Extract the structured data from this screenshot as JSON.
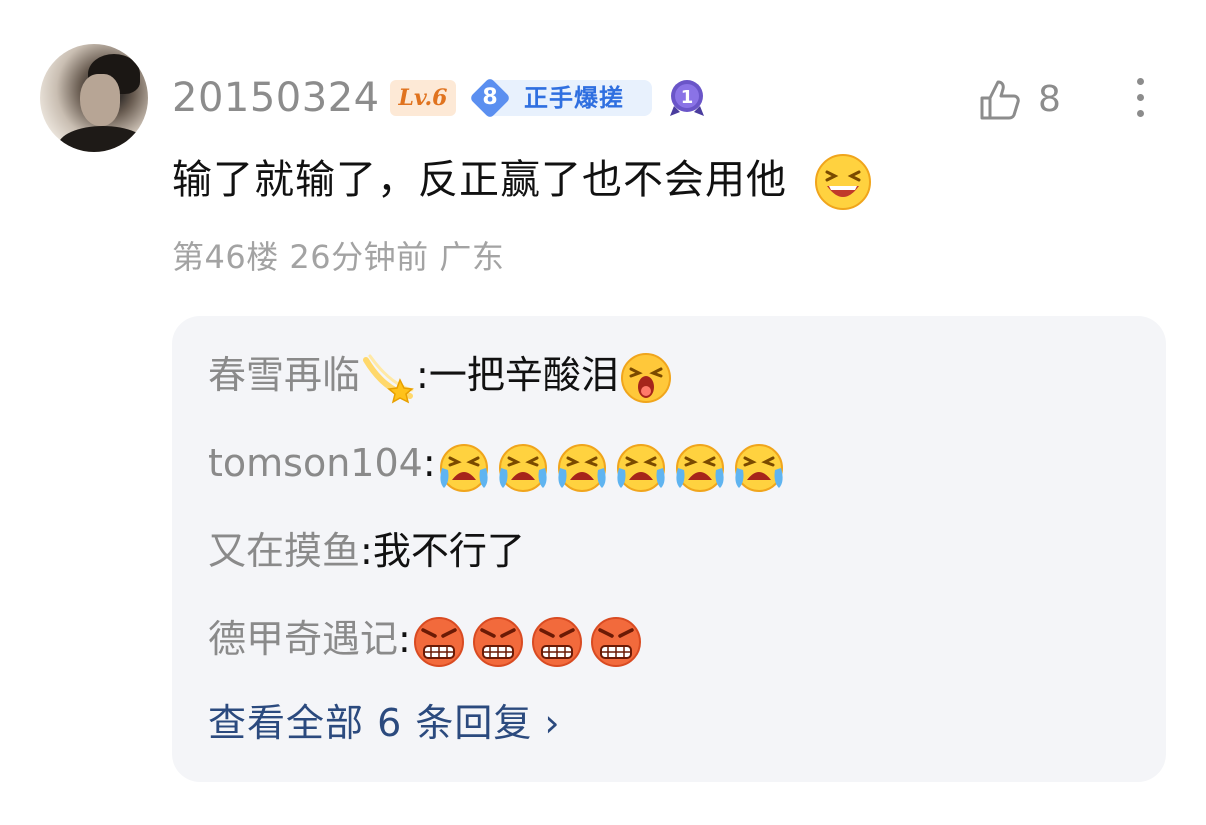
{
  "user": {
    "name": "20150324",
    "level_badge": "Lv.6",
    "medal": {
      "number": "8",
      "title": "正手爆搓"
    },
    "rank_number": "1"
  },
  "actions": {
    "like_count": "8",
    "like_icon": "thumbs-up-icon",
    "more_icon": "more-vertical-icon"
  },
  "comment": {
    "text": "输了就输了，反正赢了也不会用他",
    "emoji": "laughing-squint-emoji"
  },
  "meta": {
    "floor": "第46楼",
    "time": "26分钟前",
    "location": "广东"
  },
  "replies": [
    {
      "name": "春雪再临",
      "name_emoji": "shooting-star-emoji",
      "separator": ":",
      "text": "一把辛酸泪",
      "emojis": [
        "crying-loud-emoji"
      ]
    },
    {
      "name": "tomson104",
      "separator": ":",
      "text": "",
      "emojis": [
        "crying-face-emoji",
        "crying-face-emoji",
        "crying-face-emoji",
        "crying-face-emoji",
        "crying-face-emoji",
        "crying-face-emoji"
      ]
    },
    {
      "name": "又在摸鱼",
      "separator": ":",
      "text": "我不行了",
      "emojis": []
    },
    {
      "name": "德甲奇遇记",
      "separator": ":",
      "text": "",
      "emojis": [
        "angry-grimace-emoji",
        "angry-grimace-emoji",
        "angry-grimace-emoji",
        "angry-grimace-emoji"
      ]
    }
  ],
  "view_all": {
    "label": "查看全部 6 条回复",
    "chevron": "›"
  },
  "colors": {
    "username": "#8c8c8c",
    "level_badge_bg": "#fde9d6",
    "level_badge_text": "#e0731f",
    "medal_blue": "#2f6fe0",
    "reply_bg": "#f4f5f8",
    "view_all": "#2b4a7e"
  }
}
